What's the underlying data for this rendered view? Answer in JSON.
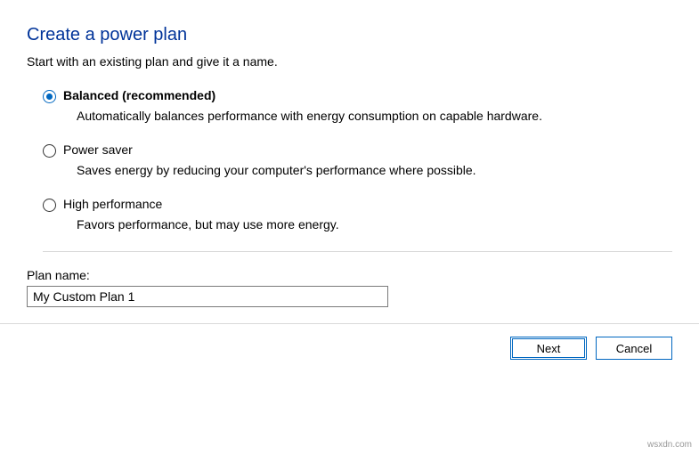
{
  "header": {
    "title": "Create a power plan",
    "subtitle": "Start with an existing plan and give it a name."
  },
  "options": [
    {
      "label": "Balanced (recommended)",
      "description": "Automatically balances performance with energy consumption on capable hardware.",
      "selected": true
    },
    {
      "label": "Power saver",
      "description": "Saves energy by reducing your computer's performance where possible.",
      "selected": false
    },
    {
      "label": "High performance",
      "description": "Favors performance, but may use more energy.",
      "selected": false
    }
  ],
  "plan_name": {
    "label": "Plan name:",
    "value": "My Custom Plan 1"
  },
  "footer": {
    "next_label": "Next",
    "cancel_label": "Cancel"
  },
  "watermark": "wsxdn.com"
}
